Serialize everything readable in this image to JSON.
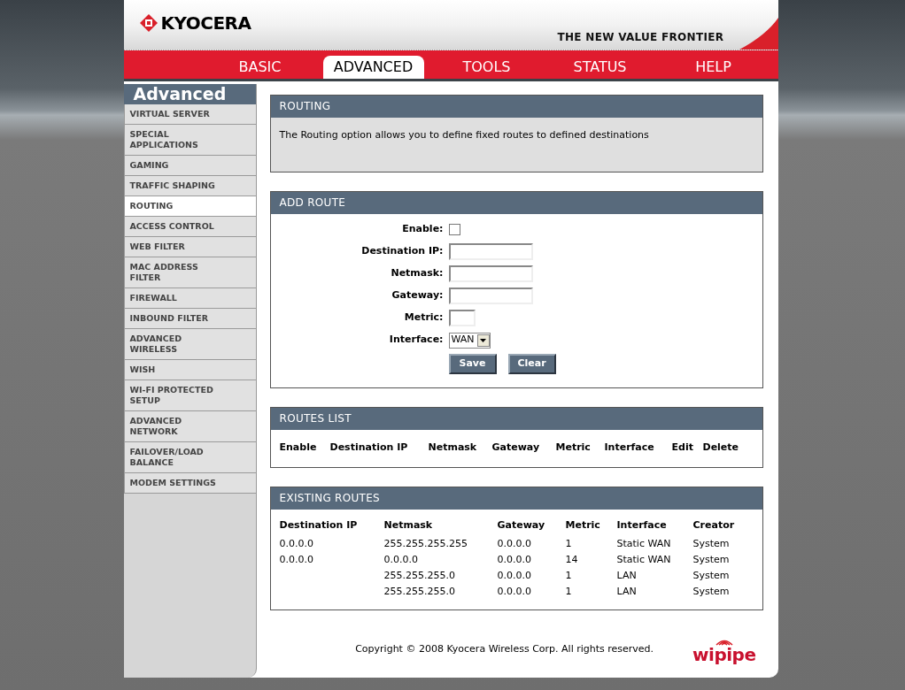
{
  "header": {
    "logo": "KYOCERA",
    "tagline": "THE NEW VALUE FRONTIER"
  },
  "tabs": [
    {
      "label": "BASIC",
      "selected": false
    },
    {
      "label": "ADVANCED",
      "selected": true
    },
    {
      "label": "TOOLS",
      "selected": false
    },
    {
      "label": "STATUS",
      "selected": false
    },
    {
      "label": "HELP",
      "selected": false
    }
  ],
  "sidebar": {
    "title": "Advanced",
    "items": [
      {
        "label": "VIRTUAL SERVER",
        "selected": false
      },
      {
        "label": "SPECIAL APPLICATIONS",
        "selected": false
      },
      {
        "label": "GAMING",
        "selected": false
      },
      {
        "label": "TRAFFIC SHAPING",
        "selected": false
      },
      {
        "label": "ROUTING",
        "selected": true
      },
      {
        "label": "ACCESS CONTROL",
        "selected": false
      },
      {
        "label": "WEB FILTER",
        "selected": false
      },
      {
        "label": "MAC ADDRESS FILTER",
        "selected": false
      },
      {
        "label": "FIREWALL",
        "selected": false
      },
      {
        "label": "INBOUND FILTER",
        "selected": false
      },
      {
        "label": "ADVANCED WIRELESS",
        "selected": false
      },
      {
        "label": "WISH",
        "selected": false
      },
      {
        "label": "WI-FI PROTECTED SETUP",
        "selected": false
      },
      {
        "label": "ADVANCED NETWORK",
        "selected": false
      },
      {
        "label": "FAILOVER/LOAD BALANCE",
        "selected": false
      },
      {
        "label": "MODEM SETTINGS",
        "selected": false
      }
    ]
  },
  "routing": {
    "title": "ROUTING",
    "description": "The Routing option allows you to define fixed routes to defined destinations"
  },
  "add_route": {
    "title": "ADD ROUTE",
    "fields": [
      {
        "kind": "checkbox",
        "label": "Enable:",
        "checked": false
      },
      {
        "kind": "text",
        "label": "Destination IP:"
      },
      {
        "kind": "text",
        "label": "Netmask:"
      },
      {
        "kind": "text",
        "label": "Gateway:"
      },
      {
        "kind": "number",
        "label": "Metric:"
      },
      {
        "kind": "select",
        "label": "Interface:",
        "value": "WAN"
      }
    ],
    "buttons": [
      "Save",
      "Clear"
    ]
  },
  "routes_list": {
    "title": "ROUTES LIST",
    "columns": [
      "Enable",
      "Destination IP",
      "Netmask",
      "Gateway",
      "Metric",
      "Interface",
      "Edit",
      "Delete"
    ]
  },
  "existing_routes": {
    "title": "EXISTING ROUTES",
    "columns": [
      "Destination IP",
      "Netmask",
      "Gateway",
      "Metric",
      "Interface",
      "Creator"
    ],
    "rows": [
      [
        "0.0.0.0",
        "255.255.255.255",
        "0.0.0.0",
        "1",
        "Static WAN",
        "System"
      ],
      [
        "0.0.0.0",
        "0.0.0.0",
        "0.0.0.0",
        "14",
        "Static WAN",
        "System"
      ],
      [
        null,
        "255.255.255.0",
        "0.0.0.0",
        "1",
        "LAN",
        "System"
      ],
      [
        null,
        "255.255.255.0",
        "0.0.0.0",
        "1",
        "LAN",
        "System"
      ]
    ]
  },
  "footer": {
    "copyright": "Copyright © 2008 Kyocera Wireless Corp. All rights reserved.",
    "logo": "wipipe"
  }
}
